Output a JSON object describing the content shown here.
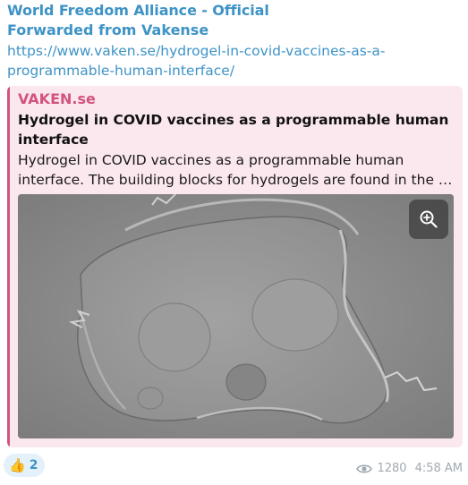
{
  "message": {
    "channel_name": "World Freedom Alliance - Official",
    "forwarded_from": "Forwarded from Vakense",
    "link_line1": "https://www.vaken.se/hydrogel-in-covid-vaccines-as-a-",
    "link_line2": "programmable-human-interface/"
  },
  "preview": {
    "site_name": "VAKEN.se",
    "title": "Hydrogel in COVID vaccines as a programmable human interface",
    "description_line1": "Hydrogel in COVID vaccines as a programmable human",
    "description_line2": "interface. The building blocks for hydrogels are found in the CO...",
    "accent_color": "#d2537f"
  },
  "reactions": [
    {
      "icon": "thumbs-up-icon",
      "emoji": "👍",
      "count": "2"
    }
  ],
  "meta": {
    "views": "1280",
    "time": "4:58 AM",
    "views_icon": "eye-icon"
  }
}
